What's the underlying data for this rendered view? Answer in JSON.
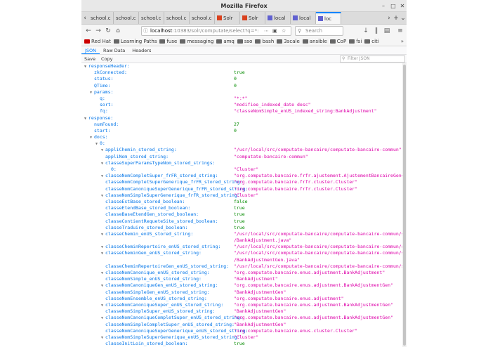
{
  "window": {
    "title": "Mozilla Firefox"
  },
  "tabs": [
    {
      "label": "school.c"
    },
    {
      "label": "school.c"
    },
    {
      "label": "school.c"
    },
    {
      "label": "school.c"
    },
    {
      "label": "school.c"
    },
    {
      "label": "Solr"
    },
    {
      "label": "Solr"
    },
    {
      "label": "local"
    },
    {
      "label": "local"
    },
    {
      "label": "loc"
    }
  ],
  "nav": {
    "url_host": "localhost",
    "url_rest": ":10383/solr/computate/select?q=*:",
    "search_placeholder": "Search"
  },
  "bookmarks": [
    "Red Hat",
    "Learning Paths",
    "fuse",
    "messaging",
    "amq",
    "sso",
    "bash",
    "3scale",
    "ansible",
    "CoP",
    "fsi",
    "citi"
  ],
  "viewer": {
    "tabs": [
      "JSON",
      "Raw Data",
      "Headers"
    ],
    "actions": [
      "Save",
      "Copy"
    ],
    "filter_placeholder": "Filter JSON"
  },
  "json_rows": [
    {
      "d": 0,
      "k": "responseHeader:",
      "t": 1
    },
    {
      "d": 1,
      "k": "zkConnected:",
      "v": "true",
      "c": "bool"
    },
    {
      "d": 1,
      "k": "status:",
      "v": "0",
      "c": "num"
    },
    {
      "d": 1,
      "k": "QTime:",
      "v": "0",
      "c": "num"
    },
    {
      "d": 1,
      "k": "params:",
      "t": 1
    },
    {
      "d": 2,
      "k": "q:",
      "v": "\"*:*\"",
      "c": "str"
    },
    {
      "d": 2,
      "k": "sort:",
      "v": "\"modifiee_indexed_date desc\"",
      "c": "str"
    },
    {
      "d": 2,
      "k": "fq:",
      "v": "\"classeNomSimple_enUS_indexed_string:BankAdjustment\"",
      "c": "str"
    },
    {
      "d": 0,
      "k": "response:",
      "t": 1
    },
    {
      "d": 1,
      "k": "numFound:",
      "v": "27",
      "c": "num"
    },
    {
      "d": 1,
      "k": "start:",
      "v": "0",
      "c": "num"
    },
    {
      "d": 1,
      "k": "docs:",
      "t": 1
    },
    {
      "d": 2,
      "k": "0:",
      "t": 1
    },
    {
      "d": 3,
      "k": "appliChemin_stored_string:",
      "v": "\"/usr/local/src/computate-bancaire/computate-bancaire-commun\"",
      "c": "str",
      "t": 1
    },
    {
      "d": 3,
      "k": "appliNom_stored_string:",
      "v": "\"computate-bancaire-commun\"",
      "c": "str"
    },
    {
      "d": 3,
      "k": "classeSuperParamsTypeNom_stored_strings:",
      "t": 1
    },
    {
      "d": 4,
      "k": "0:",
      "v": "\"Cluster\"",
      "c": "str"
    },
    {
      "d": 3,
      "k": "classeNomCompletSuper_frFR_stored_string:",
      "v": "\"org.computate.bancaire.frfr.ajustement.AjustementBancaireGen<org.computa",
      "c": "str",
      "t": 1
    },
    {
      "d": 3,
      "k": "classeNomCompletSuperGenerique_frFR_stored_string:",
      "v": "\"org.computate.bancaire.frfr.cluster.Cluster\"",
      "c": "str"
    },
    {
      "d": 3,
      "k": "classeNomCanoniqueSuperGenerique_frFR_stored_string:",
      "v": "\"org.computate.bancaire.frfr.cluster.Cluster\"",
      "c": "str"
    },
    {
      "d": 3,
      "k": "classeNomSimpleSuperGenerique_frFR_stored_string:",
      "v": "\"Cluster\"",
      "c": "str",
      "t": 1
    },
    {
      "d": 3,
      "k": "classeEstBase_stored_boolean:",
      "v": "false",
      "c": "bool"
    },
    {
      "d": 3,
      "k": "classeEtendBase_stored_boolean:",
      "v": "true",
      "c": "bool"
    },
    {
      "d": 3,
      "k": "classeBaseEtendGen_stored_boolean:",
      "v": "true",
      "c": "bool"
    },
    {
      "d": 3,
      "k": "classeContientRequeteSite_stored_boolean:",
      "v": "true",
      "c": "bool"
    },
    {
      "d": 3,
      "k": "classeTraduire_stored_boolean:",
      "v": "true",
      "c": "bool"
    },
    {
      "d": 3,
      "k": "classeChemin_enUS_stored_string:",
      "v": "\"/usr/local/src/computate-bancaire/computate-bancaire-commun/src/main/j",
      "v2": "/BankAdjustment.java\"",
      "c": "str",
      "t": 1
    },
    {
      "d": 3,
      "k": "classeCheminRepertoire_enUS_stored_string:",
      "v": "\"/usr/local/src/computate-bancaire/computate-bancaire-commun/src/main/j",
      "c": "str",
      "t": 1
    },
    {
      "d": 3,
      "k": "classeCheminGen_enUS_stored_string:",
      "v": "\"/usr/local/src/computate-bancaire/computate-bancaire-commun/src/gen/ja",
      "v2": "/BankAdjustmentGen.java\"",
      "c": "str",
      "t": 1
    },
    {
      "d": 3,
      "k": "classeCheminRepertoireGen_enUS_stored_string:",
      "v": "\"/usr/local/src/computate-bancaire/computate-bancaire-commun/src/gen/ja",
      "c": "str"
    },
    {
      "d": 3,
      "k": "classeNomCanonique_enUS_stored_string:",
      "v": "\"org.computate.bancaire.enus.adjustment.BankAdjustment\"",
      "c": "str",
      "t": 1
    },
    {
      "d": 3,
      "k": "classeNomSimple_enUS_stored_string:",
      "v": "\"BankAdjustment\"",
      "c": "str"
    },
    {
      "d": 3,
      "k": "classeNomCanoniqueGen_enUS_stored_string:",
      "v": "\"org.computate.bancaire.enus.adjustment.BankAdjustmentGen\"",
      "c": "str",
      "t": 1
    },
    {
      "d": 3,
      "k": "classeNomSimpleGen_enUS_stored_string:",
      "v": "\"BankAdjustmentGen\"",
      "c": "str"
    },
    {
      "d": 3,
      "k": "classeNomEnsemble_enUS_stored_string:",
      "v": "\"org.computate.bancaire.enus.adjustment\"",
      "c": "str"
    },
    {
      "d": 3,
      "k": "classeNomCanoniqueSuper_enUS_stored_string:",
      "v": "\"org.computate.bancaire.enus.adjustment.BankAdjustmentGen\"",
      "c": "str",
      "t": 1
    },
    {
      "d": 3,
      "k": "classeNomSimpleSuper_enUS_stored_string:",
      "v": "\"BankAdjustmentGen\"",
      "c": "str"
    },
    {
      "d": 3,
      "k": "classeNomCanoniqueCompletSuper_enUS_stored_string:",
      "v": "\"org.computate.bancaire.enus.adjustment.BankAdjustmentGen\"",
      "c": "str",
      "t": 1
    },
    {
      "d": 3,
      "k": "classeNomSimpleCompletSuper_enUS_stored_string:",
      "v": "\"BankAdjustmentGen\"",
      "c": "str"
    },
    {
      "d": 3,
      "k": "classeNomCanoniqueSuperGenerique_enUS_stored_string:",
      "v": "\"org.computate.bancaire.enus.cluster.Cluster\"",
      "c": "str"
    },
    {
      "d": 3,
      "k": "classeNomSimpleSuperGenerique_enUS_stored_string:",
      "v": "\"Cluster\"",
      "c": "str",
      "t": 1
    },
    {
      "d": 3,
      "k": "classeInitLoin_stored_boolean:",
      "v": "true",
      "c": "bool"
    }
  ]
}
